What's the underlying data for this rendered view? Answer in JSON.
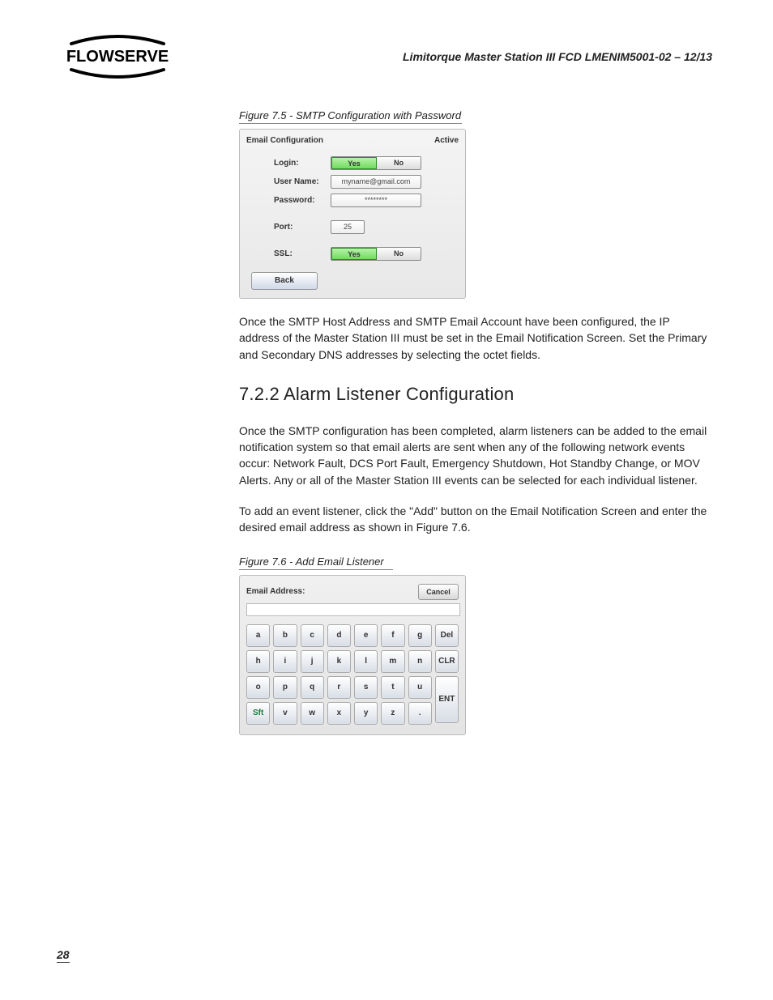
{
  "header": {
    "doc_title": "Limitorque Master Station III    FCD LMENIM5001-02 – 12/13"
  },
  "logo": {
    "text": "FLOWSERVE"
  },
  "fig75": {
    "caption": "Figure 7.5 - SMTP Configuration with Password",
    "panel_title": "Email Configuration",
    "panel_status": "Active",
    "labels": {
      "login": "Login:",
      "username": "User Name:",
      "password": "Password:",
      "port": "Port:",
      "ssl": "SSL:"
    },
    "values": {
      "login_yes": "Yes",
      "login_no": "No",
      "username": "myname@gmail.com",
      "password": "********",
      "port": "25",
      "ssl_yes": "Yes",
      "ssl_no": "No"
    },
    "back": "Back"
  },
  "para1": "Once the SMTP Host Address and SMTP Email Account have been configured, the IP address of the Master Station III must be set in the Email Notification Screen. Set the Primary and Secondary DNS addresses by selecting the octet fields.",
  "section_heading": "7.2.2 Alarm Listener Configuration",
  "para2": "Once the SMTP configuration has been completed, alarm listeners can be added to the email notification system so that email alerts are sent when any of the following network events occur: Network Fault, DCS Port Fault, Emergency Shutdown, Hot Standby Change, or MOV Alerts. Any or all of the Master Station III events can be selected for each individual listener.",
  "para3": "To add an event listener, click the \"Add\" button on the Email Notification Screen and enter the desired email address as shown in Figure 7.6.",
  "fig76": {
    "caption": "Figure 7.6 - Add Email Listener",
    "label": "Email Address:",
    "cancel": "Cancel",
    "keys_row1": [
      "a",
      "b",
      "c",
      "d",
      "e",
      "f",
      "g",
      "Del"
    ],
    "keys_row2": [
      "h",
      "i",
      "j",
      "k",
      "l",
      "m",
      "n",
      "CLR"
    ],
    "keys_row3": [
      "o",
      "p",
      "q",
      "r",
      "s",
      "t",
      "u"
    ],
    "keys_row4": [
      "Sft",
      "v",
      "w",
      "x",
      "y",
      "z",
      "."
    ],
    "ent": "ENT"
  },
  "page_number": "28"
}
